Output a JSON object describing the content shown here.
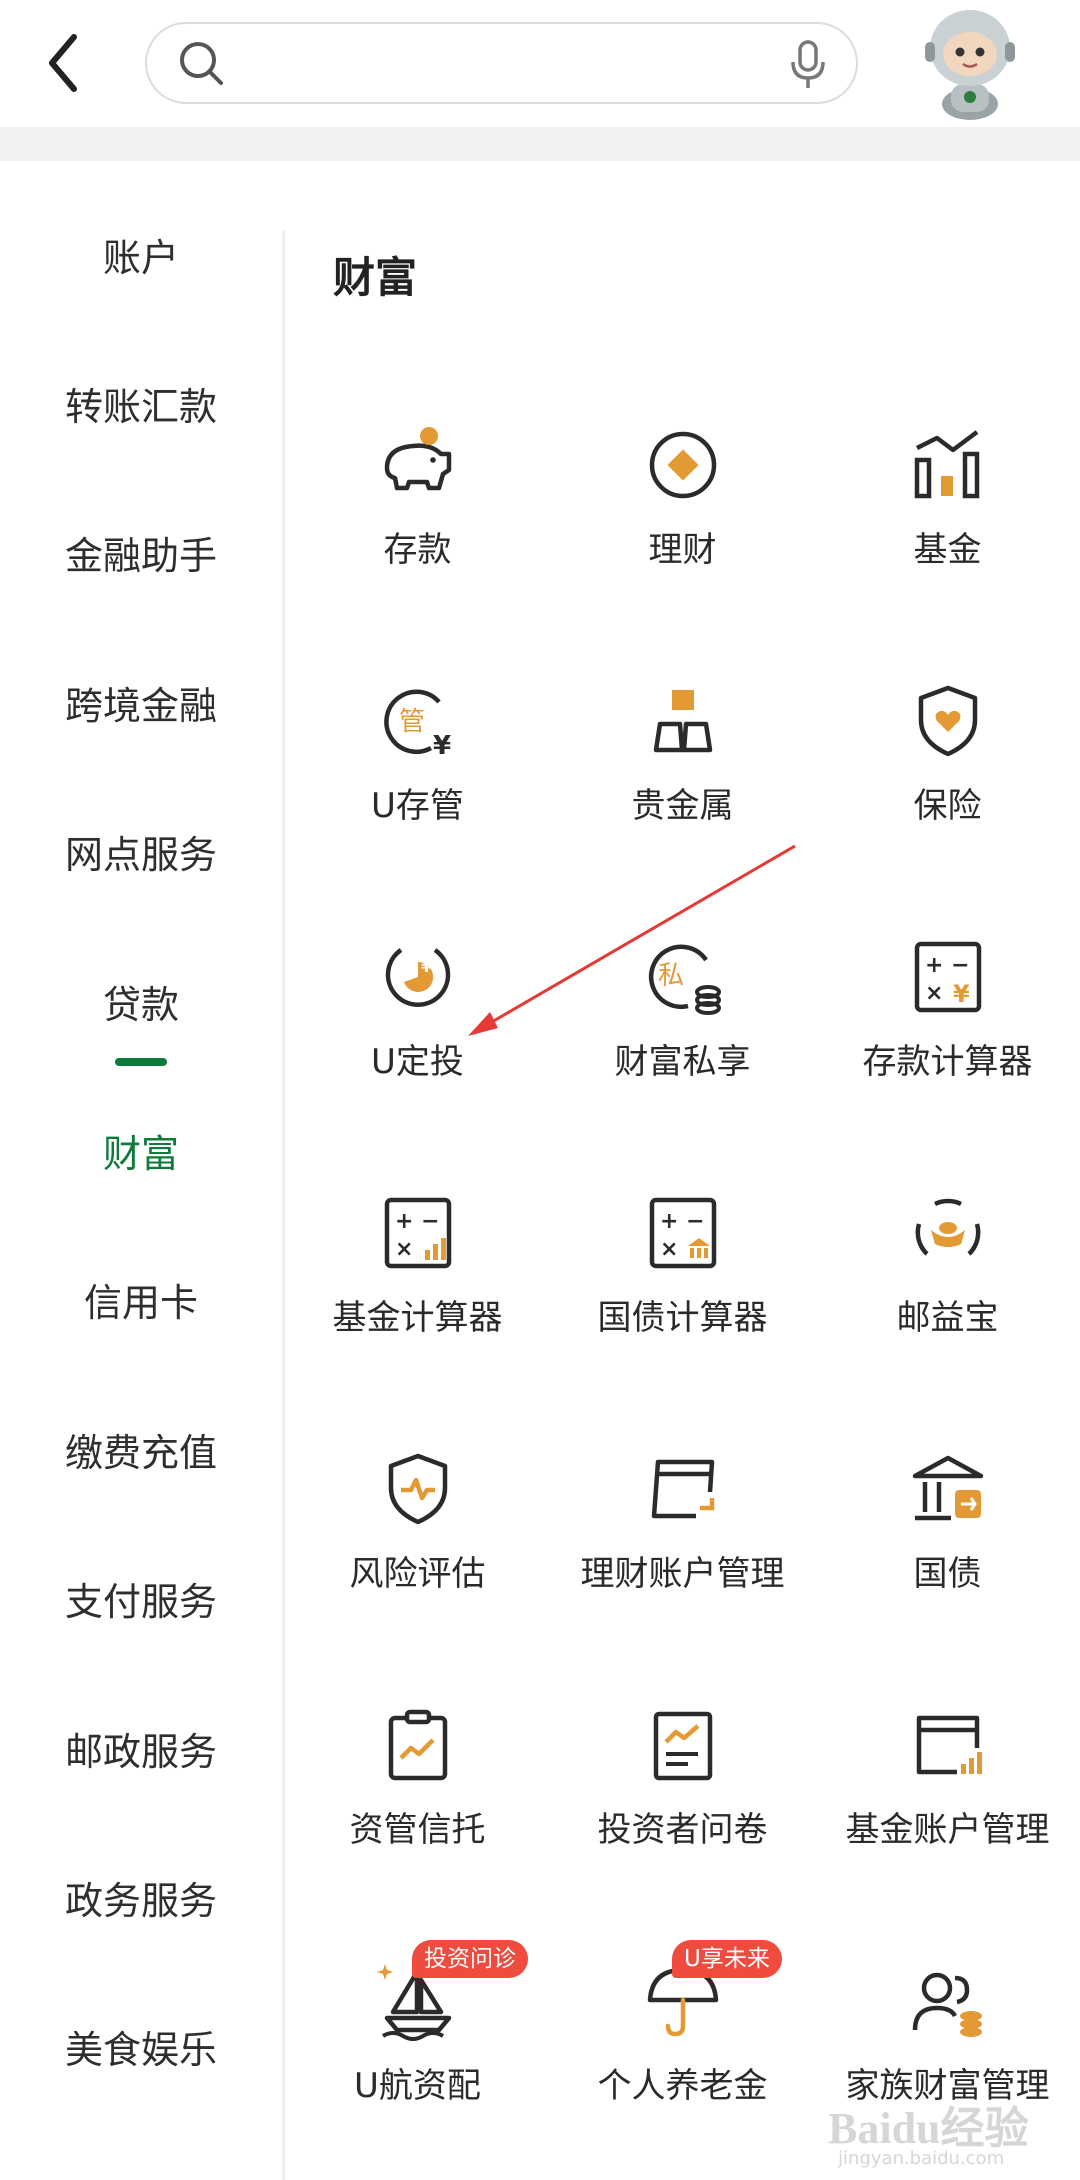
{
  "header": {
    "back_icon": "chevron-left-icon",
    "search": {
      "value": "",
      "placeholder": "",
      "icon": "search-icon",
      "mic_icon": "microphone-icon"
    },
    "avatar_icon": "robot-mascot-icon"
  },
  "sidebar": {
    "items": [
      {
        "label": "账户"
      },
      {
        "label": "转账汇款"
      },
      {
        "label": "金融助手"
      },
      {
        "label": "跨境金融"
      },
      {
        "label": "网点服务"
      },
      {
        "label": "贷款"
      },
      {
        "label": "财富"
      },
      {
        "label": "信用卡"
      },
      {
        "label": "缴费充值"
      },
      {
        "label": "支付服务"
      },
      {
        "label": "邮政服务"
      },
      {
        "label": "政务服务"
      },
      {
        "label": "美食娱乐"
      }
    ],
    "active_index": 6
  },
  "section": {
    "title": "财富",
    "items": [
      {
        "label": "存款",
        "icon": "piggy-bank-icon"
      },
      {
        "label": "理财",
        "icon": "diamond-coin-icon"
      },
      {
        "label": "基金",
        "icon": "bar-chart-trend-icon"
      },
      {
        "label": "U存管",
        "icon": "custody-yen-icon"
      },
      {
        "label": "贵金属",
        "icon": "gold-bars-icon"
      },
      {
        "label": "保险",
        "icon": "shield-heart-icon"
      },
      {
        "label": "U定投",
        "icon": "pie-yen-icon"
      },
      {
        "label": "财富私享",
        "icon": "private-coins-icon"
      },
      {
        "label": "存款计算器",
        "icon": "calculator-yen-icon"
      },
      {
        "label": "基金计算器",
        "icon": "calculator-chart-icon"
      },
      {
        "label": "国债计算器",
        "icon": "calculator-bank-icon"
      },
      {
        "label": "邮益宝",
        "icon": "ingot-cycle-icon"
      },
      {
        "label": "风险评估",
        "icon": "shield-pulse-icon"
      },
      {
        "label": "理财账户管理",
        "icon": "account-card-icon"
      },
      {
        "label": "国债",
        "icon": "bank-building-icon"
      },
      {
        "label": "资管信托",
        "icon": "clipboard-trend-icon"
      },
      {
        "label": "投资者问卷",
        "icon": "document-chart-icon"
      },
      {
        "label": "基金账户管理",
        "icon": "card-chart-icon"
      },
      {
        "label": "U航资配",
        "icon": "sailboat-icon",
        "badge": "投资问诊"
      },
      {
        "label": "个人养老金",
        "icon": "umbrella-icon",
        "badge": "U享未来"
      },
      {
        "label": "家族财富管理",
        "icon": "family-coins-icon"
      }
    ]
  },
  "annotation": {
    "color": "#e53935",
    "target": "U定投"
  },
  "watermark": {
    "brand": "Baidu经验",
    "url": "jingyan.baidu.com"
  },
  "colors": {
    "accent_green": "#0e7a3c",
    "icon_dark": "#2b2b2b",
    "icon_orange": "#e39a34",
    "badge_red": "#ef4b3f"
  }
}
